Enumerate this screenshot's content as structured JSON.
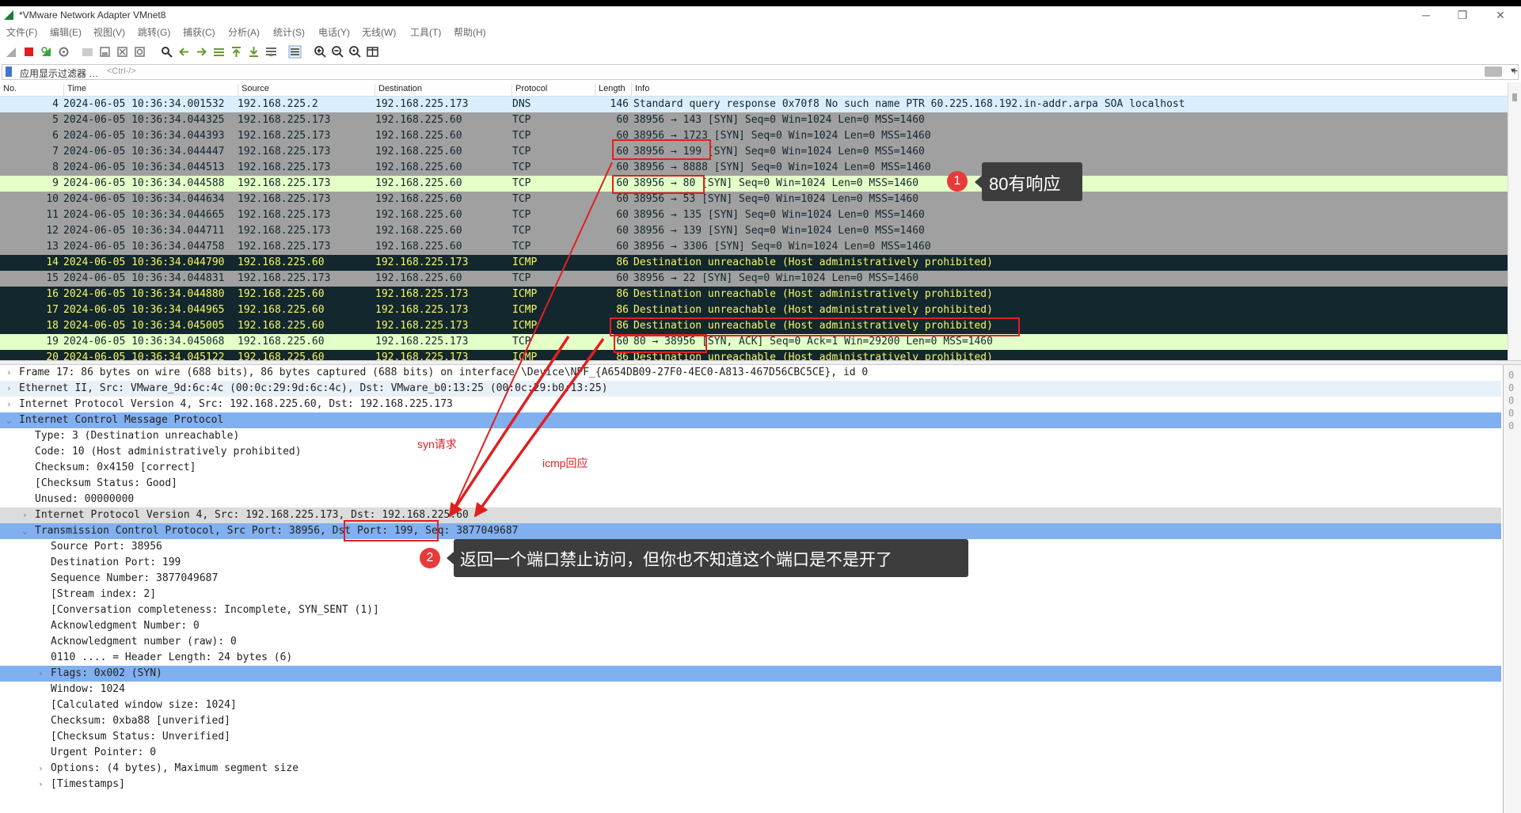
{
  "window": {
    "title": "*VMware Network Adapter VMnet8"
  },
  "menu": [
    "文件(F)",
    "编辑(E)",
    "视图(V)",
    "跳转(G)",
    "捕获(C)",
    "分析(A)",
    "统计(S)",
    "电话(Y)",
    "无线(W)",
    "工具(T)",
    "帮助(H)"
  ],
  "filter": {
    "label": "应用显示过滤器 …",
    "placeholder": "<Ctrl-/>"
  },
  "columns": {
    "no": "No.",
    "time": "Time",
    "source": "Source",
    "destination": "Destination",
    "protocol": "Protocol",
    "length": "Length",
    "info": "Info"
  },
  "packets": [
    {
      "no": "4",
      "time": "2024-06-05 10:36:34.001532",
      "src": "192.168.225.2",
      "dst": "192.168.225.173",
      "proto": "DNS",
      "len": "146",
      "info": "Standard query response 0x70f8 No such name PTR 60.225.168.192.in-addr.arpa SOA localhost",
      "style": "dns"
    },
    {
      "no": "5",
      "time": "2024-06-05 10:36:34.044325",
      "src": "192.168.225.173",
      "dst": "192.168.225.60",
      "proto": "TCP",
      "len": "60",
      "info": "38956 → 143 [SYN] Seq=0 Win=1024 Len=0 MSS=1460",
      "style": "tcp"
    },
    {
      "no": "6",
      "time": "2024-06-05 10:36:34.044393",
      "src": "192.168.225.173",
      "dst": "192.168.225.60",
      "proto": "TCP",
      "len": "60",
      "info": "38956 → 1723 [SYN] Seq=0 Win=1024 Len=0 MSS=1460",
      "style": "tcp"
    },
    {
      "no": "7",
      "time": "2024-06-05 10:36:34.044447",
      "src": "192.168.225.173",
      "dst": "192.168.225.60",
      "proto": "TCP",
      "len": "60",
      "info": "38956 → 199 [SYN] Seq=0 Win=1024 Len=0 MSS=1460",
      "style": "tcp"
    },
    {
      "no": "8",
      "time": "2024-06-05 10:36:34.044513",
      "src": "192.168.225.173",
      "dst": "192.168.225.60",
      "proto": "TCP",
      "len": "60",
      "info": "38956 → 8888 [SYN] Seq=0 Win=1024 Len=0 MSS=1460",
      "style": "tcp"
    },
    {
      "no": "9",
      "time": "2024-06-05 10:36:34.044588",
      "src": "192.168.225.173",
      "dst": "192.168.225.60",
      "proto": "TCP",
      "len": "60",
      "info": "38956 → 80 [SYN] Seq=0 Win=1024 Len=0 MSS=1460",
      "style": "hl"
    },
    {
      "no": "10",
      "time": "2024-06-05 10:36:34.044634",
      "src": "192.168.225.173",
      "dst": "192.168.225.60",
      "proto": "TCP",
      "len": "60",
      "info": "38956 → 53 [SYN] Seq=0 Win=1024 Len=0 MSS=1460",
      "style": "tcp"
    },
    {
      "no": "11",
      "time": "2024-06-05 10:36:34.044665",
      "src": "192.168.225.173",
      "dst": "192.168.225.60",
      "proto": "TCP",
      "len": "60",
      "info": "38956 → 135 [SYN] Seq=0 Win=1024 Len=0 MSS=1460",
      "style": "tcp"
    },
    {
      "no": "12",
      "time": "2024-06-05 10:36:34.044711",
      "src": "192.168.225.173",
      "dst": "192.168.225.60",
      "proto": "TCP",
      "len": "60",
      "info": "38956 → 139 [SYN] Seq=0 Win=1024 Len=0 MSS=1460",
      "style": "tcp"
    },
    {
      "no": "13",
      "time": "2024-06-05 10:36:34.044758",
      "src": "192.168.225.173",
      "dst": "192.168.225.60",
      "proto": "TCP",
      "len": "60",
      "info": "38956 → 3306 [SYN] Seq=0 Win=1024 Len=0 MSS=1460",
      "style": "tcp"
    },
    {
      "no": "14",
      "time": "2024-06-05 10:36:34.044790",
      "src": "192.168.225.60",
      "dst": "192.168.225.173",
      "proto": "ICMP",
      "len": "86",
      "info": "Destination unreachable (Host administratively prohibited)",
      "style": "icmp"
    },
    {
      "no": "15",
      "time": "2024-06-05 10:36:34.044831",
      "src": "192.168.225.173",
      "dst": "192.168.225.60",
      "proto": "TCP",
      "len": "60",
      "info": "38956 → 22 [SYN] Seq=0 Win=1024 Len=0 MSS=1460",
      "style": "tcp"
    },
    {
      "no": "16",
      "time": "2024-06-05 10:36:34.044880",
      "src": "192.168.225.60",
      "dst": "192.168.225.173",
      "proto": "ICMP",
      "len": "86",
      "info": "Destination unreachable (Host administratively prohibited)",
      "style": "icmp"
    },
    {
      "no": "17",
      "time": "2024-06-05 10:36:34.044965",
      "src": "192.168.225.60",
      "dst": "192.168.225.173",
      "proto": "ICMP",
      "len": "86",
      "info": "Destination unreachable (Host administratively prohibited)",
      "style": "icmp"
    },
    {
      "no": "18",
      "time": "2024-06-05 10:36:34.045005",
      "src": "192.168.225.60",
      "dst": "192.168.225.173",
      "proto": "ICMP",
      "len": "86",
      "info": "Destination unreachable (Host administratively prohibited)",
      "style": "icmp"
    },
    {
      "no": "19",
      "time": "2024-06-05 10:36:34.045068",
      "src": "192.168.225.60",
      "dst": "192.168.225.173",
      "proto": "TCP",
      "len": "60",
      "info": "80 → 38956 [SYN, ACK] Seq=0 Ack=1 Win=29200 Len=0 MSS=1460",
      "style": "hl"
    },
    {
      "no": "20",
      "time": "2024-06-05 10:36:34.045122",
      "src": "192.168.225.60",
      "dst": "192.168.225.173",
      "proto": "ICMP",
      "len": "86",
      "info": "Destination unreachable (Host administratively prohibited)",
      "style": "icmp"
    }
  ],
  "details": [
    {
      "text": "Frame 17: 86 bytes on wire (688 bits), 86 bytes captured (688 bits) on interface \\Device\\NPF_{A654DB09-27F0-4EC0-A813-467D56CBC5CE}, id 0",
      "indent": 0,
      "arrow": "›",
      "style": ""
    },
    {
      "text": "Ethernet II, Src: VMware_9d:6c:4c (00:0c:29:9d:6c:4c), Dst: VMware_b0:13:25 (00:0c:29:b0:13:25)",
      "indent": 0,
      "arrow": "›",
      "style": "lite"
    },
    {
      "text": "Internet Protocol Version 4, Src: 192.168.225.60, Dst: 192.168.225.173",
      "indent": 0,
      "arrow": "›",
      "style": ""
    },
    {
      "text": "Internet Control Message Protocol",
      "indent": 0,
      "arrow": "⌄",
      "style": "sel"
    },
    {
      "text": "Type: 3 (Destination unreachable)",
      "indent": 1,
      "arrow": "",
      "style": ""
    },
    {
      "text": "Code: 10 (Host administratively prohibited)",
      "indent": 1,
      "arrow": "",
      "style": ""
    },
    {
      "text": "Checksum: 0x4150 [correct]",
      "indent": 1,
      "arrow": "",
      "style": ""
    },
    {
      "text": "[Checksum Status: Good]",
      "indent": 1,
      "arrow": "",
      "style": ""
    },
    {
      "text": "Unused: 00000000",
      "indent": 1,
      "arrow": "",
      "style": ""
    },
    {
      "text": "Internet Protocol Version 4, Src: 192.168.225.173, Dst: 192.168.225.60",
      "indent": 1,
      "arrow": "›",
      "style": "gray"
    },
    {
      "text": "Transmission Control Protocol, Src Port: 38956, Dst Port: 199, Seq: 3877049687",
      "indent": 1,
      "arrow": "⌄",
      "style": "sel"
    },
    {
      "text": "Source Port: 38956",
      "indent": 2,
      "arrow": "",
      "style": ""
    },
    {
      "text": "Destination Port: 199",
      "indent": 2,
      "arrow": "",
      "style": ""
    },
    {
      "text": "Sequence Number: 3877049687",
      "indent": 2,
      "arrow": "",
      "style": ""
    },
    {
      "text": "[Stream index: 2]",
      "indent": 2,
      "arrow": "",
      "style": ""
    },
    {
      "text": "[Conversation completeness: Incomplete, SYN_SENT (1)]",
      "indent": 2,
      "arrow": "",
      "style": ""
    },
    {
      "text": "Acknowledgment Number: 0",
      "indent": 2,
      "arrow": "",
      "style": ""
    },
    {
      "text": "Acknowledgment number (raw): 0",
      "indent": 2,
      "arrow": "",
      "style": ""
    },
    {
      "text": "0110 .... = Header Length: 24 bytes (6)",
      "indent": 2,
      "arrow": "",
      "style": ""
    },
    {
      "text": "Flags: 0x002 (SYN)",
      "indent": 2,
      "arrow": "›",
      "style": "sel"
    },
    {
      "text": "Window: 1024",
      "indent": 2,
      "arrow": "",
      "style": ""
    },
    {
      "text": "[Calculated window size: 1024]",
      "indent": 2,
      "arrow": "",
      "style": ""
    },
    {
      "text": "Checksum: 0xba88 [unverified]",
      "indent": 2,
      "arrow": "",
      "style": ""
    },
    {
      "text": "[Checksum Status: Unverified]",
      "indent": 2,
      "arrow": "",
      "style": ""
    },
    {
      "text": "Urgent Pointer: 0",
      "indent": 2,
      "arrow": "",
      "style": ""
    },
    {
      "text": "Options: (4 bytes), Maximum segment size",
      "indent": 2,
      "arrow": "›",
      "style": ""
    },
    {
      "text": "[Timestamps]",
      "indent": 2,
      "arrow": "›",
      "style": ""
    }
  ],
  "bytes_digits": [
    "0",
    "0",
    "0",
    "0",
    "0"
  ],
  "annotations": {
    "callout1": {
      "badge": "1",
      "text": "80有响应"
    },
    "callout2": {
      "badge": "2",
      "text": "返回一个端口禁止访问，但你也不知道这个端口是不是开了"
    },
    "syn_label": "syn请求",
    "icmp_label": "icmp回应"
  },
  "colors": {
    "accent_red": "#e02020",
    "selected_blue": "#80b0ef",
    "icmp_bg": "#12272e",
    "icmp_fg": "#f7f760",
    "tcp_bg": "#a0a0a0",
    "hl_bg": "#e4ffc7",
    "dns_bg": "#daeeff"
  }
}
